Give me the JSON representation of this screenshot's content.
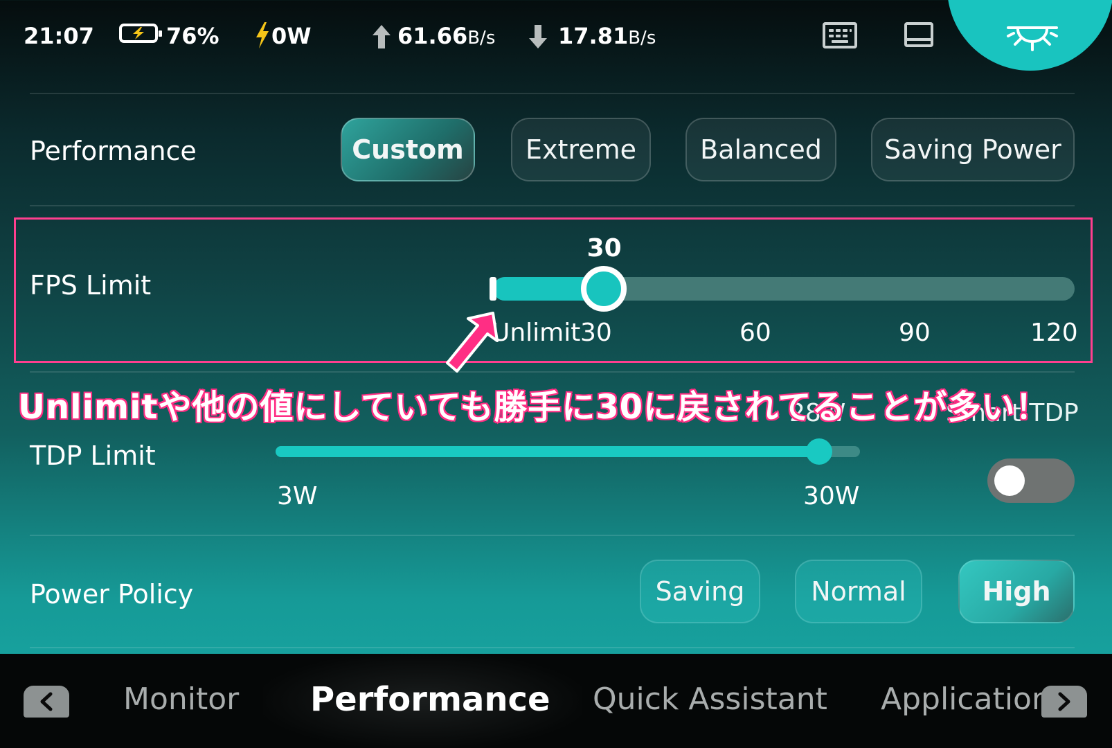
{
  "status_bar": {
    "time": "21:07",
    "battery": "76%",
    "power": "0W",
    "upload": "61.66",
    "upload_unit": "B/s",
    "download": "17.81",
    "download_unit": "B/s"
  },
  "performance": {
    "label": "Performance",
    "modes": [
      "Custom",
      "Extreme",
      "Balanced",
      "Saving Power"
    ],
    "selected": "Custom"
  },
  "fps_limit": {
    "label": "FPS Limit",
    "value_label": "30",
    "ticks": [
      "Unlimit",
      "30",
      "60",
      "90",
      "120"
    ],
    "level_fraction": 0.19
  },
  "annotation": {
    "text": "Unlimitや他の値にしていても勝手に30に戻されてることが多い！"
  },
  "tdp_limit": {
    "label": "TDP Limit",
    "value_label": "28W",
    "min_label": "3W",
    "max_label": "30W",
    "level_fraction": 0.93,
    "smart_tdp_label": "Smart TDP",
    "smart_tdp_on": false
  },
  "power_policy": {
    "label": "Power Policy",
    "options": [
      "Saving",
      "Normal",
      "High"
    ],
    "selected": "High"
  },
  "bottom_nav": {
    "items": [
      "Monitor",
      "Performance",
      "Quick Assistant",
      "Application"
    ],
    "selected": "Performance"
  },
  "colors": {
    "accent": "#18c4be",
    "annotation_stroke": "#ff2e84",
    "highlight_border": "#ff3f8f",
    "power_bolt": "#f5c518"
  }
}
